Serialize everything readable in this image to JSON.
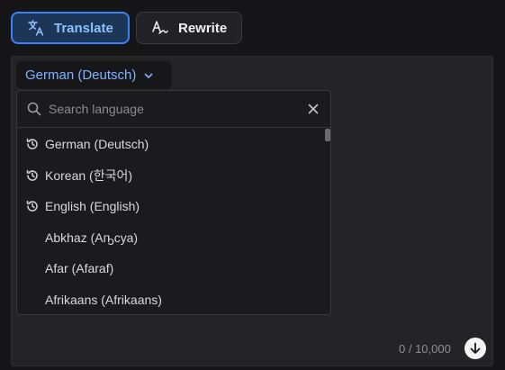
{
  "mode_tabs": {
    "translate_label": "Translate",
    "rewrite_label": "Rewrite"
  },
  "language_selector": {
    "selected": "German (Deutsch)"
  },
  "dropdown": {
    "search_placeholder": "Search language",
    "languages": [
      {
        "label": "German (Deutsch)",
        "recent": true
      },
      {
        "label": "Korean (한국어)",
        "recent": true
      },
      {
        "label": "English (English)",
        "recent": true
      },
      {
        "label": "Abkhaz (Аҧсуа)",
        "recent": false
      },
      {
        "label": "Afar (Afaraf)",
        "recent": false
      },
      {
        "label": "Afrikaans (Afrikaans)",
        "recent": false
      }
    ]
  },
  "footer": {
    "char_count": "0 / 10,000"
  },
  "colors": {
    "accent": "#3b82f6",
    "accent_text": "#8cc0ff",
    "background": "#161618",
    "panel": "#242427"
  }
}
